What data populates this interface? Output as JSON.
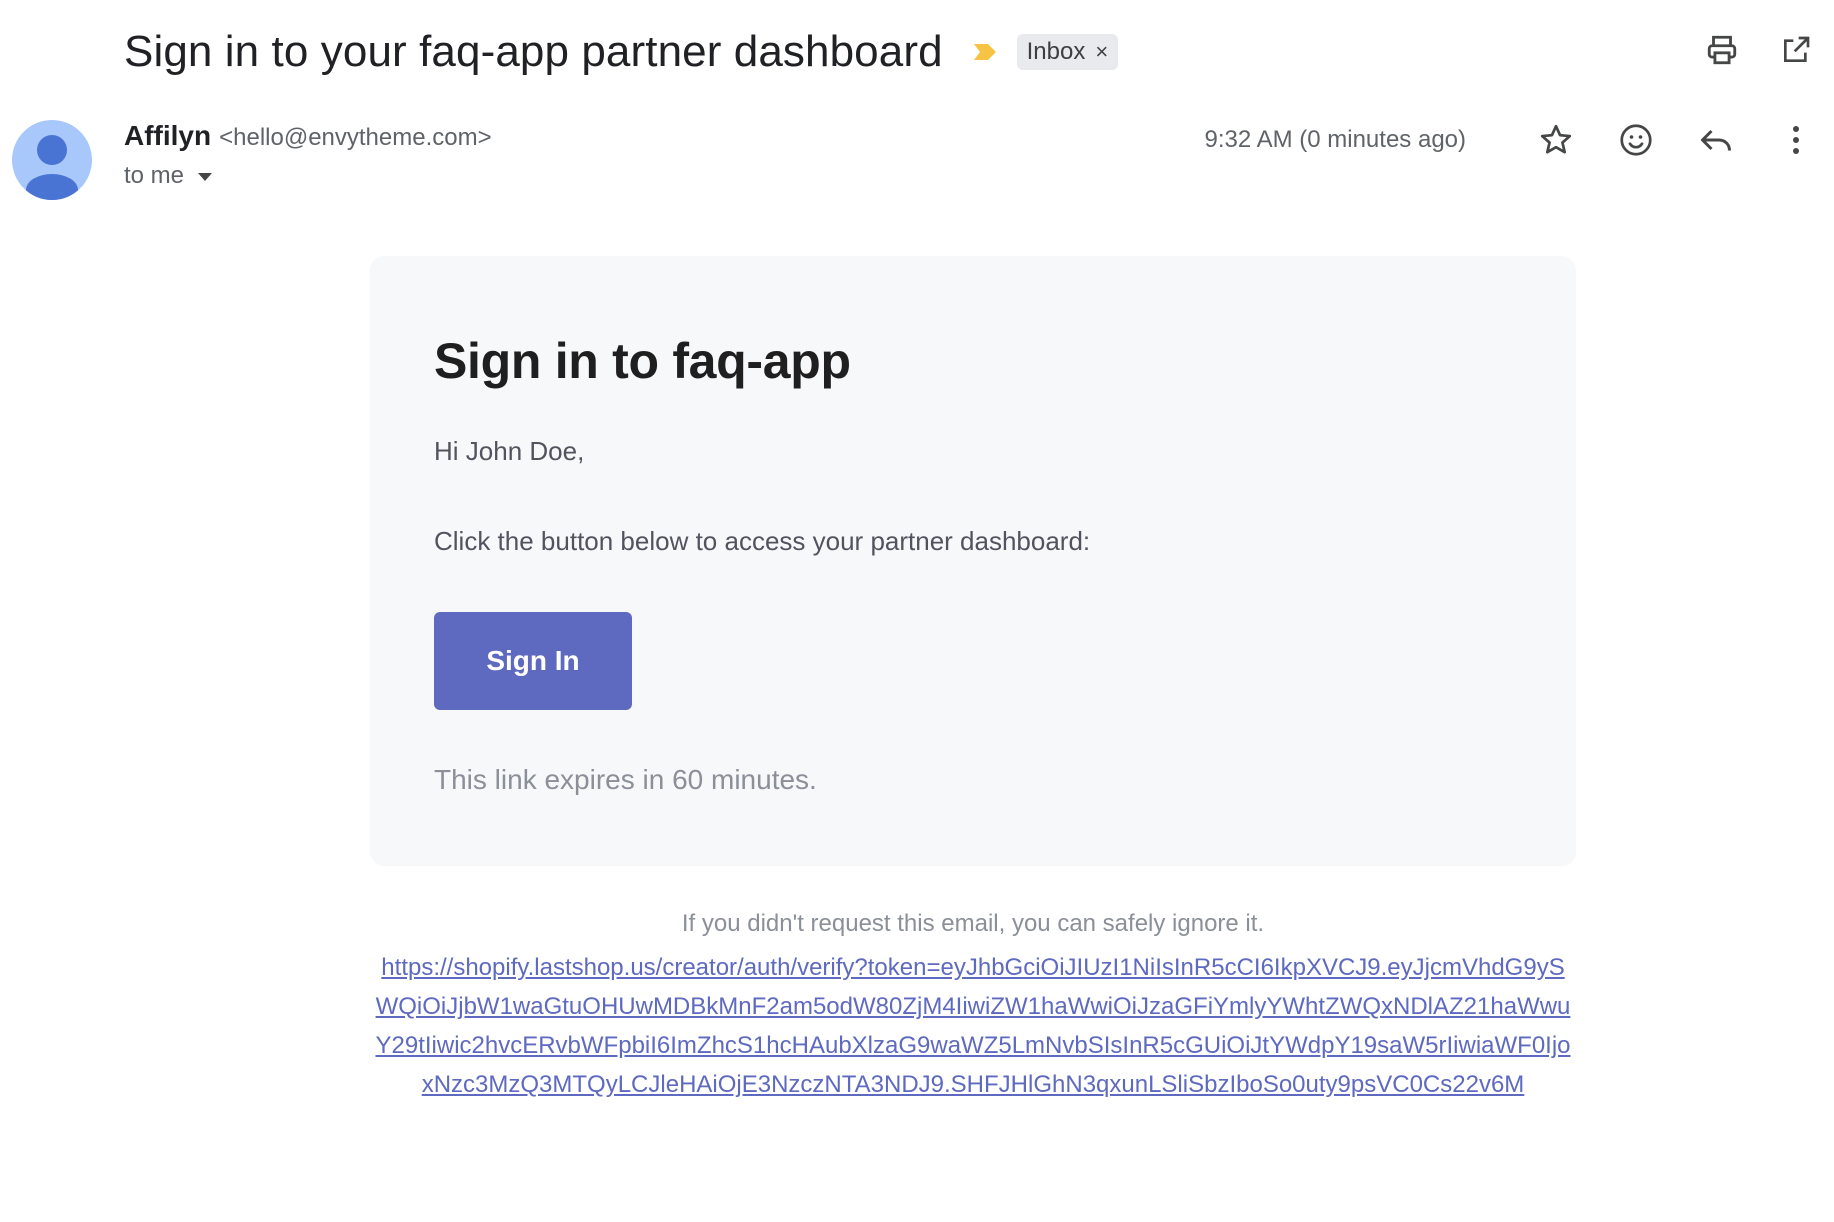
{
  "email": {
    "subject": "Sign in to your faq-app partner dashboard",
    "label": "Inbox",
    "label_close": "×",
    "sender": {
      "name": "Affilyn",
      "email": "<hello@envytheme.com>"
    },
    "recipient": "to me",
    "timestamp": "9:32 AM (0 minutes ago)"
  },
  "icons": {
    "importance": "importance-marker-icon",
    "print": "print-icon",
    "open_new_window": "open-in-new-icon",
    "star": "star-icon",
    "emoji": "emoji-icon",
    "reply": "reply-icon",
    "more": "more-vert-icon",
    "avatar": "person-avatar-icon",
    "dropdown": "chevron-down-icon"
  },
  "body": {
    "heading": "Sign in to faq-app",
    "greeting": "Hi John Doe,",
    "instruction": "Click the button below to access your partner dashboard:",
    "button_label": "Sign In",
    "expiry": "This link expires in 60 minutes."
  },
  "footer": {
    "note": "If you didn't request this email, you can safely ignore it.",
    "link": "https://shopify.lastshop.us/creator/auth/verify?token=eyJhbGciOiJIUzI1NiIsInR5cCI6IkpXVCJ9.eyJjcmVhdG9ySWQiOiJjbW1waGtuOHUwMDBkMnF2am5odW80ZjM4IiwiZW1haWwiOiJzaGFiYmlyYWhtZWQxNDlAZ21haWwuY29tIiwic2hvcERvbWFpbiI6ImZhcS1hcHAubXlzaG9waWZ5LmNvbSIsInR5cGUiOiJtYWdpY19saW5rIiwiaWF0IjoxNzc3MzQ3MTQyLCJleHAiOjE3NzczNTA3NDJ9.SHFJHlGhN3qxunLSliSbzIboSo0uty9psVC0Cs22v6M"
  },
  "colors": {
    "accent": "#5e69c0",
    "card_bg": "#f7f8fa",
    "importance": "#f6c344",
    "avatar_bg": "#a8c7fa",
    "avatar_fg": "#4a74d4"
  }
}
